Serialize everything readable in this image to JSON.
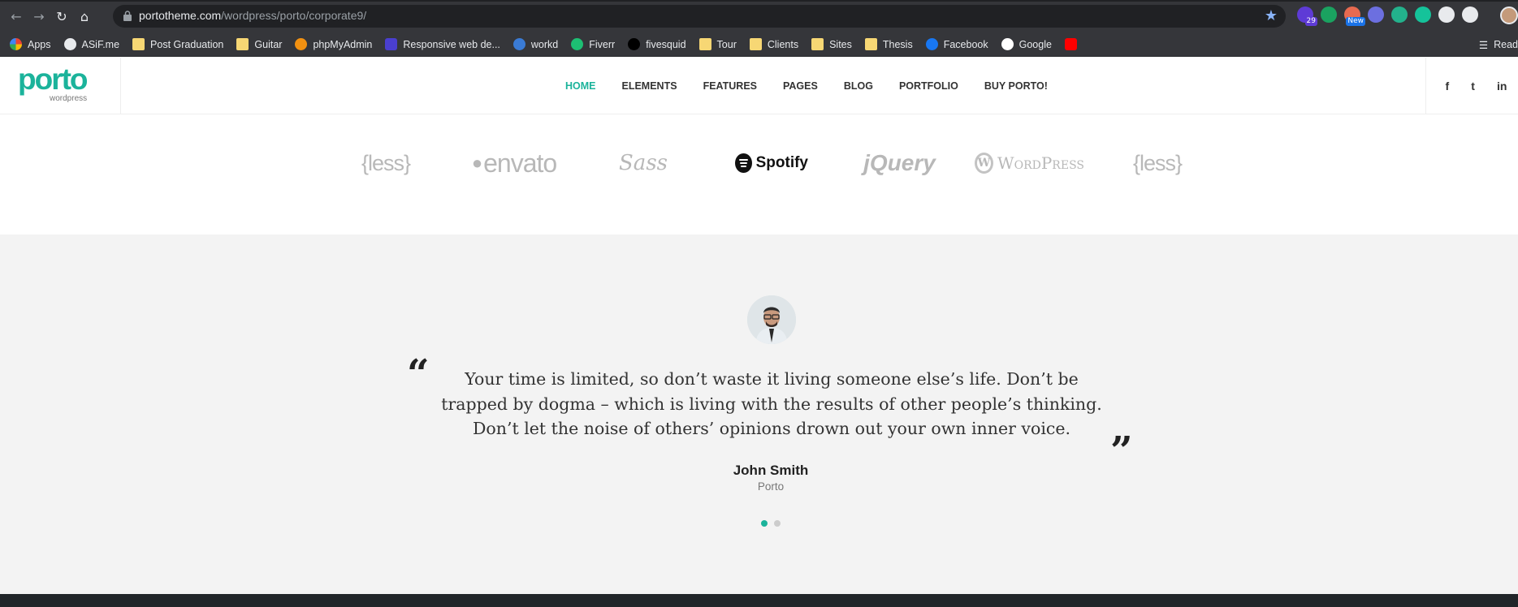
{
  "browser": {
    "url_host": "portotheme.com",
    "url_path": "/wordpress/porto/corporate9/",
    "extensions": [
      {
        "name": "graduation-cap-icon",
        "badge": "29",
        "color": "#5e3bd6"
      },
      {
        "name": "refresh-green-icon",
        "badge": "",
        "color": "#1aa260"
      },
      {
        "name": "rainbow-icon",
        "badge": "New",
        "color": "#e86a50"
      },
      {
        "name": "pen-icon",
        "badge": "",
        "color": "#6c6fe0"
      },
      {
        "name": "plant-icon",
        "badge": "",
        "color": "#23b28c"
      },
      {
        "name": "grammarly-icon",
        "badge": "",
        "color": "#15c39a"
      },
      {
        "name": "puzzle-icon",
        "badge": "",
        "color": "#e8eaed"
      },
      {
        "name": "media-queue-icon",
        "badge": "",
        "color": "#e8eaed"
      }
    ]
  },
  "bookmarks": [
    {
      "label": "Apps",
      "icon": "apps-grid-icon"
    },
    {
      "label": "ASiF.me",
      "icon": "globe-icon"
    },
    {
      "label": "Post Graduation",
      "icon": "folder-icon"
    },
    {
      "label": "Guitar",
      "icon": "folder-icon"
    },
    {
      "label": "phpMyAdmin",
      "icon": "phpmyadmin-icon"
    },
    {
      "label": "Responsive web de...",
      "icon": "w-icon"
    },
    {
      "label": "workd",
      "icon": "workd-icon"
    },
    {
      "label": "Fiverr",
      "icon": "fiverr-icon"
    },
    {
      "label": "fivesquid",
      "icon": "f-icon"
    },
    {
      "label": "Tour",
      "icon": "folder-icon"
    },
    {
      "label": "Clients",
      "icon": "folder-icon"
    },
    {
      "label": "Sites",
      "icon": "folder-icon"
    },
    {
      "label": "Thesis",
      "icon": "folder-icon"
    },
    {
      "label": "Facebook",
      "icon": "facebook-icon"
    },
    {
      "label": "Google",
      "icon": "google-icon"
    },
    {
      "label": "",
      "icon": "youtube-icon"
    }
  ],
  "reading_list_label": "Read",
  "site": {
    "logo": "porto",
    "logo_sub": "wordpress",
    "nav": [
      "HOME",
      "ELEMENTS",
      "FEATURES",
      "PAGES",
      "BLOG",
      "PORTFOLIO",
      "BUY PORTO!"
    ],
    "nav_active": "HOME",
    "social": [
      "f",
      "t",
      "in"
    ]
  },
  "clients": [
    "{less}",
    "envato",
    "Sass",
    "Spotify",
    "jQuery",
    "WordPress",
    "{less}"
  ],
  "testimonial": {
    "quote_open": "“",
    "quote_close": "”",
    "text": "Your time is limited, so don’t waste it living someone else’s life. Don’t be trapped by dogma – which is living with the results of other people’s thinking. Don’t let the noise of others’ opinions drown out your own inner voice.",
    "name": "John Smith",
    "company": "Porto",
    "slides": 2,
    "active_slide": 1
  },
  "colors": {
    "accent": "#1bb39b",
    "chrome_bg": "#35363a",
    "testimonial_bg": "#f3f3f3"
  }
}
